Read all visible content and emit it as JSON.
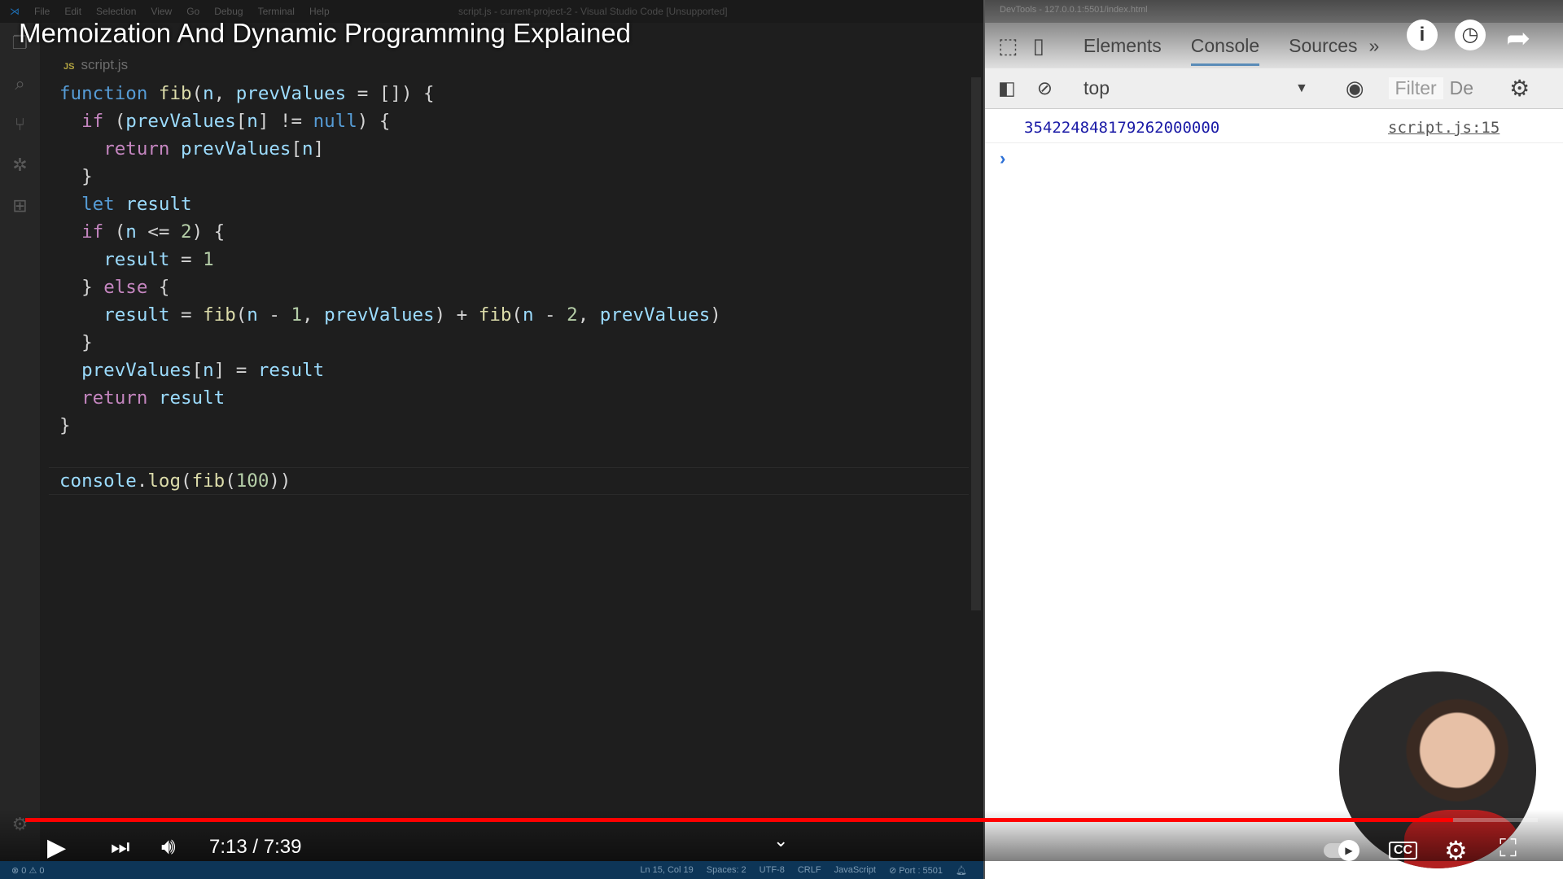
{
  "video": {
    "title": "Memoization And Dynamic Programming Explained",
    "current_time": "7:13",
    "duration": "7:39",
    "time_sep": " / ",
    "progress_percent": 94.4,
    "buffered_percent": 99.9
  },
  "vscode": {
    "menu": [
      "File",
      "Edit",
      "Selection",
      "View",
      "Go",
      "Debug",
      "Terminal",
      "Help"
    ],
    "window_title": "script.js - current-project-2 - Visual Studio Code [Unsupported]",
    "tab": "script.js",
    "tab_icon": "JS",
    "status": {
      "left": "⊗ 0 ⚠ 0",
      "items": [
        "Ln 15, Col 19",
        "Spaces: 2",
        "UTF-8",
        "CRLF",
        "JavaScript",
        "⊘ Port : 5501"
      ]
    }
  },
  "code_lines": [
    [
      [
        "kw",
        "function "
      ],
      [
        "fn",
        "fib"
      ],
      [
        "",
        "("
      ],
      [
        "v",
        "n"
      ],
      [
        "",
        ", "
      ],
      [
        "v",
        "prevValues"
      ],
      [
        "",
        " = []) {"
      ]
    ],
    [
      [
        "",
        "  "
      ],
      [
        "kc",
        "if"
      ],
      [
        "",
        " ("
      ],
      [
        "v",
        "prevValues"
      ],
      [
        "",
        "["
      ],
      [
        "v",
        "n"
      ],
      [
        "",
        "] != "
      ],
      [
        "kw",
        "null"
      ],
      [
        "",
        ") {"
      ]
    ],
    [
      [
        "",
        "    "
      ],
      [
        "kc",
        "return "
      ],
      [
        "v",
        "prevValues"
      ],
      [
        "",
        "["
      ],
      [
        "v",
        "n"
      ],
      [
        "",
        "]"
      ]
    ],
    [
      [
        "",
        "  }"
      ]
    ],
    [
      [
        "",
        "  "
      ],
      [
        "kw",
        "let "
      ],
      [
        "v",
        "result"
      ]
    ],
    [
      [
        "",
        "  "
      ],
      [
        "kc",
        "if"
      ],
      [
        "",
        " ("
      ],
      [
        "v",
        "n"
      ],
      [
        "",
        " <= "
      ],
      [
        "n",
        "2"
      ],
      [
        "",
        ") {"
      ]
    ],
    [
      [
        "",
        "    "
      ],
      [
        "v",
        "result"
      ],
      [
        "",
        " = "
      ],
      [
        "n",
        "1"
      ]
    ],
    [
      [
        "",
        "  } "
      ],
      [
        "kc",
        "else"
      ],
      [
        "",
        " {"
      ]
    ],
    [
      [
        "",
        "    "
      ],
      [
        "v",
        "result"
      ],
      [
        "",
        " = "
      ],
      [
        "fn",
        "fib"
      ],
      [
        "",
        "("
      ],
      [
        "v",
        "n"
      ],
      [
        "",
        " - "
      ],
      [
        "n",
        "1"
      ],
      [
        "",
        ", "
      ],
      [
        "v",
        "prevValues"
      ],
      [
        "",
        ") + "
      ],
      [
        "fn",
        "fib"
      ],
      [
        "",
        "("
      ],
      [
        "v",
        "n"
      ],
      [
        "",
        " - "
      ],
      [
        "n",
        "2"
      ],
      [
        "",
        ", "
      ],
      [
        "v",
        "prevValues"
      ],
      [
        "",
        ")"
      ]
    ],
    [
      [
        "",
        "  }"
      ]
    ],
    [
      [
        "",
        "  "
      ],
      [
        "v",
        "prevValues"
      ],
      [
        "",
        "["
      ],
      [
        "v",
        "n"
      ],
      [
        "",
        "] = "
      ],
      [
        "v",
        "result"
      ]
    ],
    [
      [
        "",
        "  "
      ],
      [
        "kc",
        "return "
      ],
      [
        "v",
        "result"
      ]
    ],
    [
      [
        "",
        "}"
      ]
    ],
    [
      [
        "",
        ""
      ]
    ],
    [
      [
        "v",
        "console"
      ],
      [
        "",
        "."
      ],
      [
        "fn",
        "log"
      ],
      [
        "",
        "("
      ],
      [
        "fn",
        "fib"
      ],
      [
        "",
        "("
      ],
      [
        "n",
        "100"
      ],
      [
        "",
        "))"
      ]
    ]
  ],
  "devtools": {
    "window_title": "DevTools - 127.0.0.1:5501/index.html",
    "tabs": [
      "Elements",
      "Console",
      "Sources"
    ],
    "active_tab": "Console",
    "context": "top",
    "filter_placeholder": "Filter",
    "levels": "De",
    "log_value": "354224848179262000000",
    "log_source": "script.js:15",
    "prompt": "›"
  }
}
